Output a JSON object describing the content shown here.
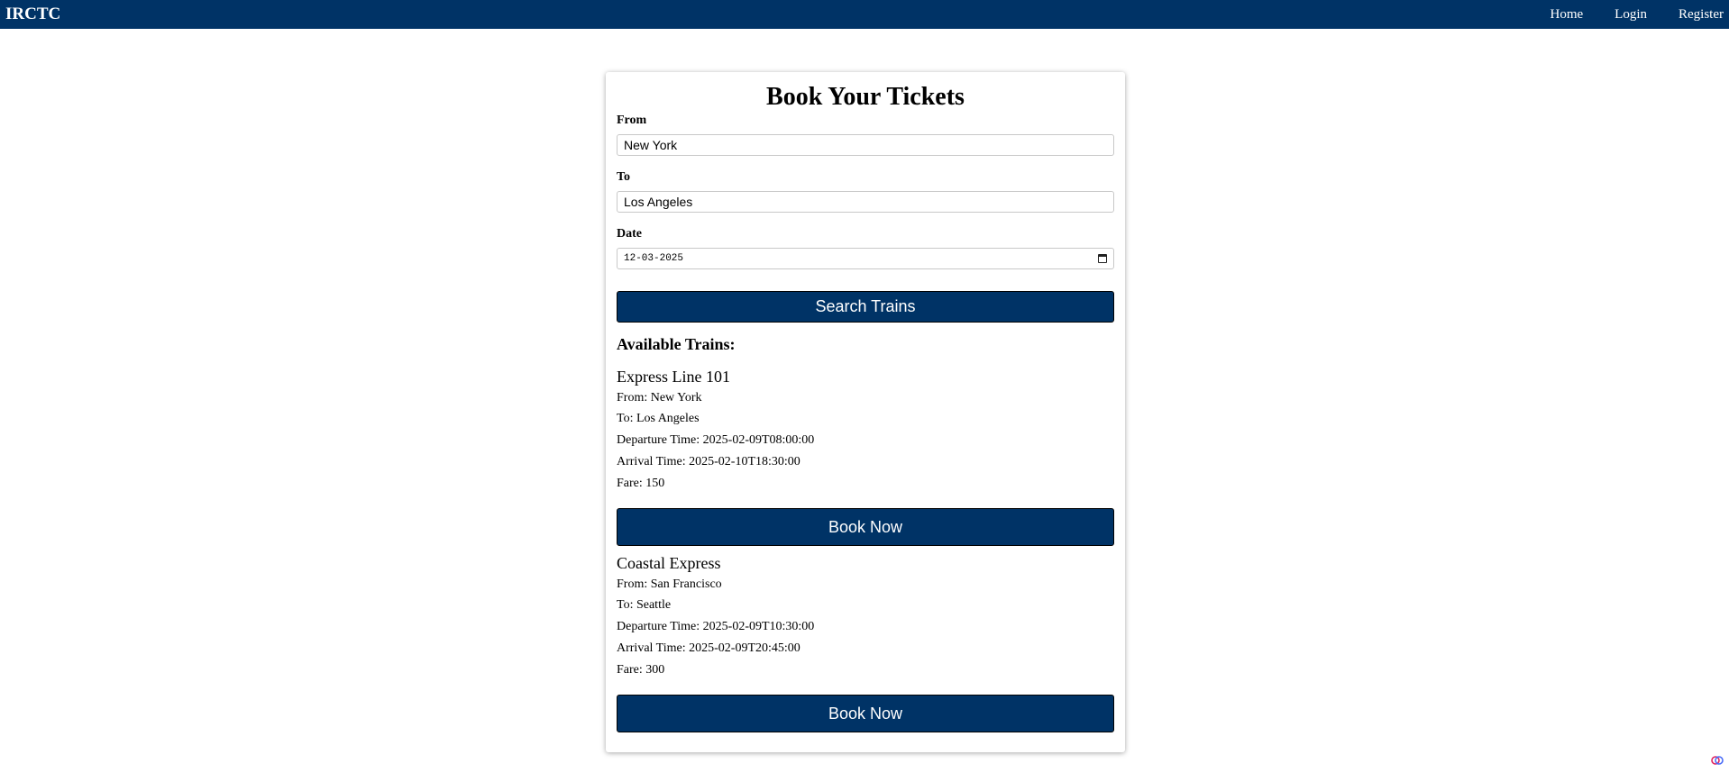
{
  "navbar": {
    "brand": "IRCTC",
    "links": [
      "Home",
      "Login",
      "Register"
    ]
  },
  "form": {
    "title": "Book Your Tickets",
    "from_label": "From",
    "from_value": "New York",
    "to_label": "To",
    "to_value": "Los Angeles",
    "date_label": "Date",
    "date_value": "12-03-2025",
    "search_label": "Search Trains"
  },
  "results": {
    "heading": "Available Trains:",
    "trains": [
      {
        "name": "Express Line 101",
        "from": "From: New York",
        "to": "To: Los Angeles",
        "departure": "Departure Time: 2025-02-09T08:00:00",
        "arrival": "Arrival Time: 2025-02-10T18:30:00",
        "fare": "Fare: 150",
        "book_label": "Book Now"
      },
      {
        "name": "Coastal Express",
        "from": "From: San Francisco",
        "to": "To: Seattle",
        "departure": "Departure Time: 2025-02-09T10:30:00",
        "arrival": "Arrival Time: 2025-02-09T20:45:00",
        "fare": "Fare: 300",
        "book_label": "Book Now"
      }
    ]
  },
  "colors": {
    "primary": "#003366",
    "background": "#ffffff"
  },
  "icons": {
    "date_picker": "calendar-icon",
    "floating_widget": "extension-icon"
  }
}
